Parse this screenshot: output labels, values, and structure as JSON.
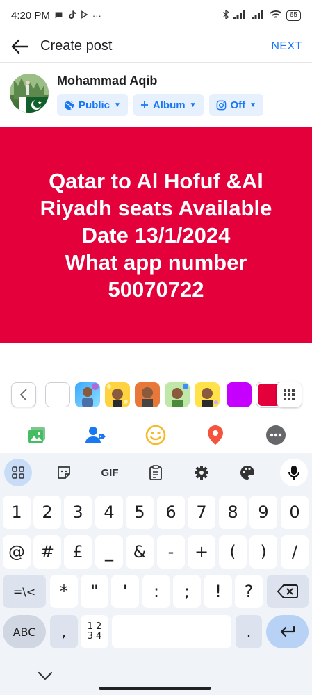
{
  "status_bar": {
    "time": "4:20 PM",
    "more": "···",
    "battery": "65"
  },
  "header": {
    "title": "Create post",
    "next_label": "NEXT"
  },
  "user": {
    "name": "Mohammad Aqib",
    "audience_label": "Public",
    "album_label": "Album",
    "instagram_label": "Off"
  },
  "post": {
    "text": "Qatar to Al Hofuf &Al\nRiyadh seats Available\nDate 13/1/2024\nWhat app number\n50070722",
    "background_color": "#e4003b"
  },
  "background_picker": {
    "swatch_colors": [
      "#ffffff",
      "avatar-blue",
      "avatar-yellow",
      "avatar-orange",
      "avatar-green",
      "avatar-yellow2",
      "#c600ff",
      "#e4003b"
    ]
  },
  "actions": [
    "photo-icon",
    "tag-people-icon",
    "feeling-icon",
    "location-icon",
    "more-icon"
  ],
  "keyboard": {
    "toolbar": {
      "gif_label": "GIF"
    },
    "row1": [
      "1",
      "2",
      "3",
      "4",
      "5",
      "6",
      "7",
      "8",
      "9",
      "0"
    ],
    "row2": [
      "@",
      "#",
      "£",
      "_",
      "&",
      "-",
      "+",
      "(",
      ")",
      "/"
    ],
    "row3": [
      "=\\<",
      "*",
      "\"",
      "'",
      ":",
      ";",
      "!",
      "?"
    ],
    "row4": {
      "abc": "ABC",
      "comma": ",",
      "numpad_line1": "1 2",
      "numpad_line2": "3 4",
      "period": "."
    }
  }
}
